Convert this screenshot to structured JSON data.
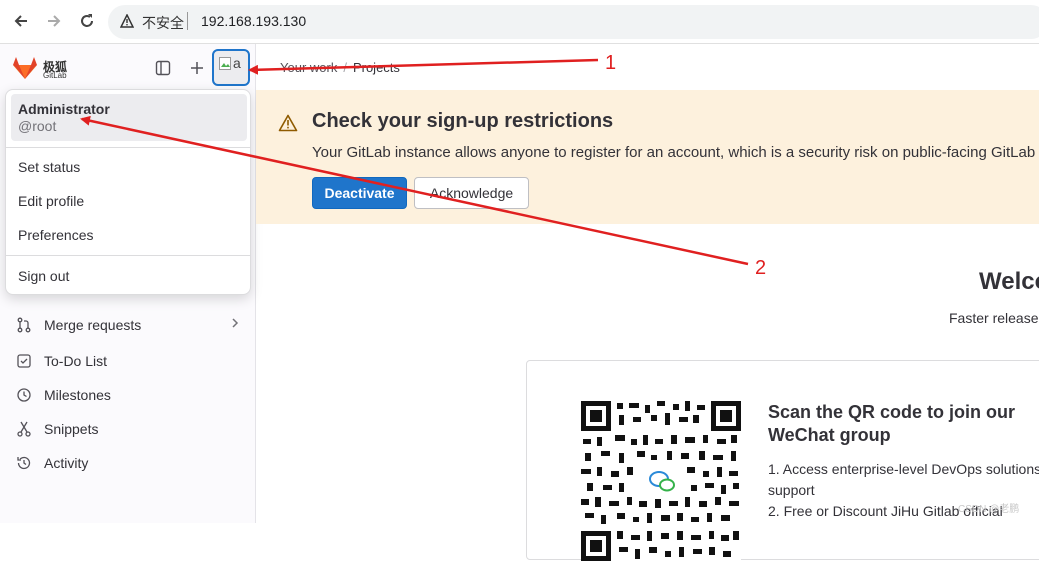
{
  "browser": {
    "security_label": "不安全",
    "url": "192.168.193.130"
  },
  "sidebar": {
    "brand_cn": "极狐",
    "brand_en": "GitLab",
    "avatar_alt": "a",
    "items": [
      {
        "label": "Merge requests",
        "icon": "merge-request-icon",
        "has_chevron": true
      },
      {
        "label": "To-Do List",
        "icon": "todo-icon"
      },
      {
        "label": "Milestones",
        "icon": "clock-icon"
      },
      {
        "label": "Snippets",
        "icon": "snippet-icon"
      },
      {
        "label": "Activity",
        "icon": "history-icon"
      }
    ]
  },
  "user_menu": {
    "name": "Administrator",
    "handle": "@root",
    "items": [
      "Set status",
      "Edit profile",
      "Preferences"
    ],
    "sign_out": "Sign out"
  },
  "breadcrumb": {
    "parent": "Your work",
    "current": "Projects"
  },
  "banner": {
    "title": "Check your sign-up restrictions",
    "text": "Your GitLab instance allows anyone to register for an account, which is a security risk on public-facing GitLab",
    "primary_button": "Deactivate",
    "secondary_button": "Acknowledge"
  },
  "welcome": {
    "title": "Welco",
    "subtitle": "Faster release"
  },
  "wechat_card": {
    "title": "Scan the QR code to join our WeChat group",
    "items": [
      "1. Access enterprise-level DevOps solutions support",
      "2. Free or Discount JiHu Gitlab official"
    ]
  },
  "annotations": {
    "label_1": "1",
    "label_2": "2"
  },
  "watermark": "CSDN @老鹏",
  "colors": {
    "accent": "#1f75cb",
    "banner_bg": "#fdf1dd",
    "annotation": "#e02020"
  }
}
